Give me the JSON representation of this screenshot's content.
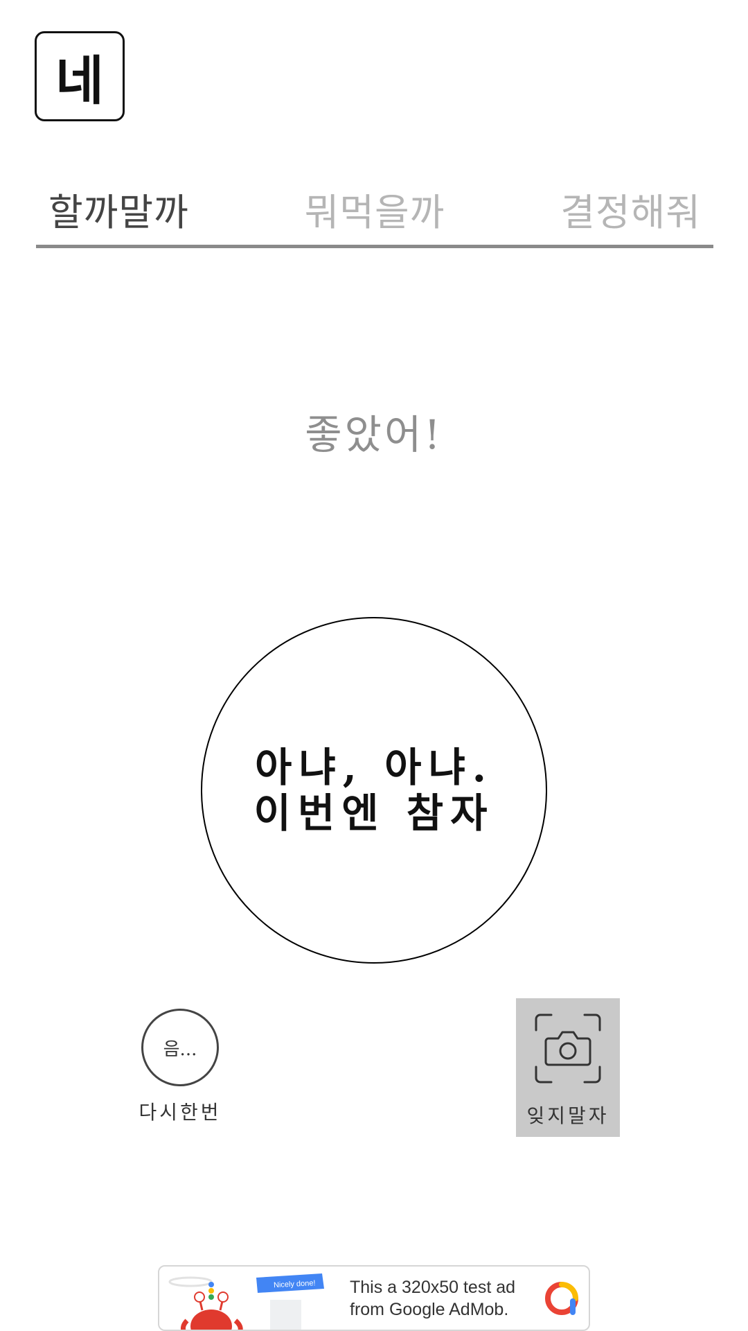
{
  "app": {
    "logo_text": "네"
  },
  "tabs": [
    {
      "label": "할까말까",
      "active": true
    },
    {
      "label": "뭐먹을까",
      "active": false
    },
    {
      "label": "결정해줘",
      "active": false
    }
  ],
  "status_text": "좋았어!",
  "decision": {
    "line1": "아냐, 아냐.",
    "line2": "이번엔 참자"
  },
  "retry": {
    "button_text": "음...",
    "label": "다시한번"
  },
  "capture": {
    "label": "잊지말자",
    "icon": "camera-icon"
  },
  "ad": {
    "banner_text": "Nicely done!",
    "line1": "This a 320x50 test ad",
    "line2": "from Google AdMob."
  },
  "colors": {
    "active_tab": "#444444",
    "inactive_tab": "#b5b5b5",
    "status": "#8e8e8e",
    "capture_bg": "#c9c9c9"
  }
}
